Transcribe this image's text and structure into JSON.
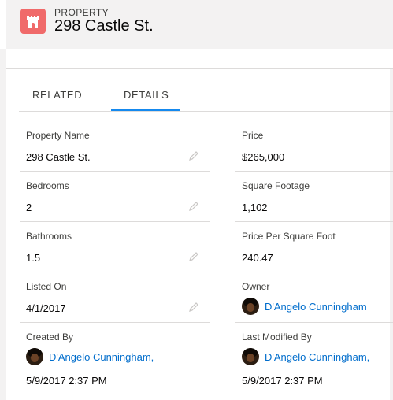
{
  "header": {
    "object_type": "PROPERTY",
    "title": "298 Castle St.",
    "icon": "castle-icon",
    "icon_color": "#f06a6a"
  },
  "tabs": [
    {
      "label": "RELATED",
      "active": false
    },
    {
      "label": "DETAILS",
      "active": true
    }
  ],
  "accent_color": "#1589ee",
  "link_color": "#006dcc",
  "fields": {
    "property_name": {
      "label": "Property Name",
      "value": "298 Castle St."
    },
    "price": {
      "label": "Price",
      "value": "$265,000"
    },
    "bedrooms": {
      "label": "Bedrooms",
      "value": "2"
    },
    "square_footage": {
      "label": "Square Footage",
      "value": "1,102"
    },
    "bathrooms": {
      "label": "Bathrooms",
      "value": "1.5"
    },
    "price_per_sqft": {
      "label": "Price Per Square Foot",
      "value": "240.47"
    },
    "listed_on": {
      "label": "Listed On",
      "value": "4/1/2017"
    },
    "owner": {
      "label": "Owner",
      "value": "D'Angelo Cunningham"
    },
    "created_by": {
      "label": "Created By",
      "user": "D'Angelo Cunningham,",
      "datetime": "5/9/2017 2:37 PM"
    },
    "last_modified_by": {
      "label": "Last Modified By",
      "user": "D'Angelo Cunningham,",
      "datetime": "5/9/2017 2:37 PM"
    }
  }
}
